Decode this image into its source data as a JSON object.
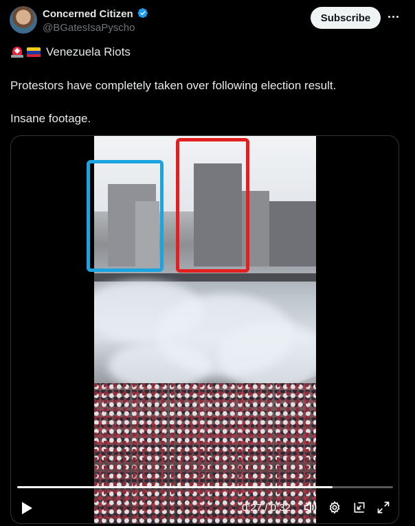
{
  "post": {
    "author_name": "Concerned Citizen",
    "author_handle": "@BGatesIsaPyscho",
    "avatar_text": "",
    "subscribe_label": "Subscribe",
    "text_line1": "Venezuela Riots",
    "text_line2": "Protestors have completely taken over following election result.",
    "text_line3": "Insane footage."
  },
  "icons": {
    "verified": "verified-badge-icon",
    "more": "more-icon",
    "emoji_1": "police-light-icon",
    "emoji_2": "venezuela-flag-icon",
    "play": "play-icon",
    "volume": "volume-icon",
    "settings": "gear-icon",
    "pip": "picture-in-picture-icon",
    "fullscreen": "fullscreen-icon"
  },
  "video": {
    "time_display": "0:27 / 0:32",
    "progress_fraction": 0.84
  },
  "colors": {
    "verified": "#1d9bf0",
    "blue_box": "#1ca4e0",
    "red_box": "#e41f1f"
  }
}
